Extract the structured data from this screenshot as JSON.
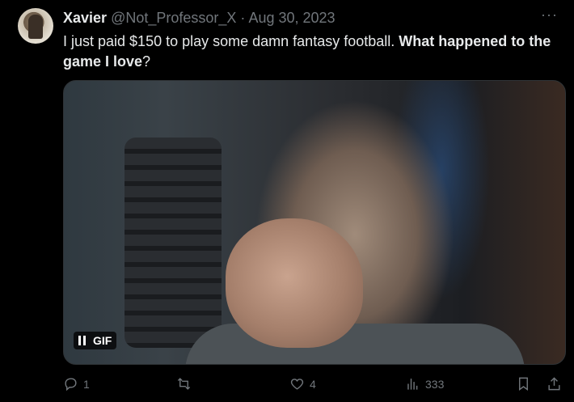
{
  "tweet": {
    "author_name": "Xavier",
    "handle": "@Not_Professor_X",
    "separator": "·",
    "date": "Aug 30, 2023",
    "more_label": "···",
    "text_plain": "I just paid $150 to play some damn fantasy football. ",
    "text_bold": "What happened to the game I love",
    "text_end": "?"
  },
  "media": {
    "badge_label": "GIF",
    "icon": "pause-icon"
  },
  "actions": {
    "reply_count": "1",
    "repost_count": "",
    "like_count": "4",
    "views_count": "333",
    "icons": [
      "reply-icon",
      "repost-icon",
      "like-icon",
      "views-icon",
      "bookmark-icon",
      "share-icon"
    ]
  },
  "colors": {
    "background": "#000000",
    "text": "#e7e9ea",
    "muted": "#71767b",
    "border": "#2f3336"
  }
}
